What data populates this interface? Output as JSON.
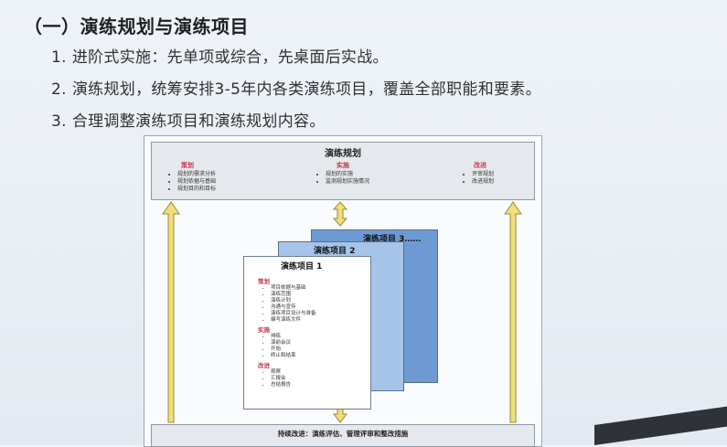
{
  "heading": "（一）演练规划与演练项目",
  "points": [
    {
      "num": "1.",
      "text": "进阶式实施：先单项或综合，先桌面后实战。"
    },
    {
      "num": "2.",
      "text": "演练规划，统筹安排3-5年内各类演练项目，覆盖全部职能和要素。"
    },
    {
      "num": "3.",
      "text": "合理调整演练项目和演练规划内容。"
    }
  ],
  "diagram": {
    "plan_box": {
      "title": "演练规划",
      "columns": [
        {
          "head": "策划",
          "items": [
            "规划的需求分析",
            "规划依据与基础",
            "规划目的和目标"
          ]
        },
        {
          "head": "实施",
          "items": [
            "规划的实施",
            "监测规划实施情况"
          ]
        },
        {
          "head": "改进",
          "items": [
            "评审规划",
            "改进规划"
          ]
        }
      ]
    },
    "project3_title": "演练项目 3……",
    "project2_title": "演练项目 2",
    "project1": {
      "title": "演练项目 1",
      "sections": [
        {
          "head": "策划",
          "items": [
            "项目依据与基础",
            "演练范围",
            "演练计划",
            "沟通与宣传",
            "演练项目设计与准备",
            "编写演练文件"
          ]
        },
        {
          "head": "实施",
          "items": [
            "排练",
            "演前会议",
            "开始",
            "终止和结束"
          ]
        },
        {
          "head": "改进",
          "items": [
            "观察",
            "汇报会",
            "总结报告"
          ]
        }
      ]
    },
    "bottom_bar": "持续改进：演练评估、管理评审和整改措施",
    "colors": {
      "accent_red": "#c23b4e",
      "arrow_yellow": "#f1dd7a",
      "project3_blue": "#6e9ad3",
      "project2_blue": "#a6c4ea"
    }
  }
}
